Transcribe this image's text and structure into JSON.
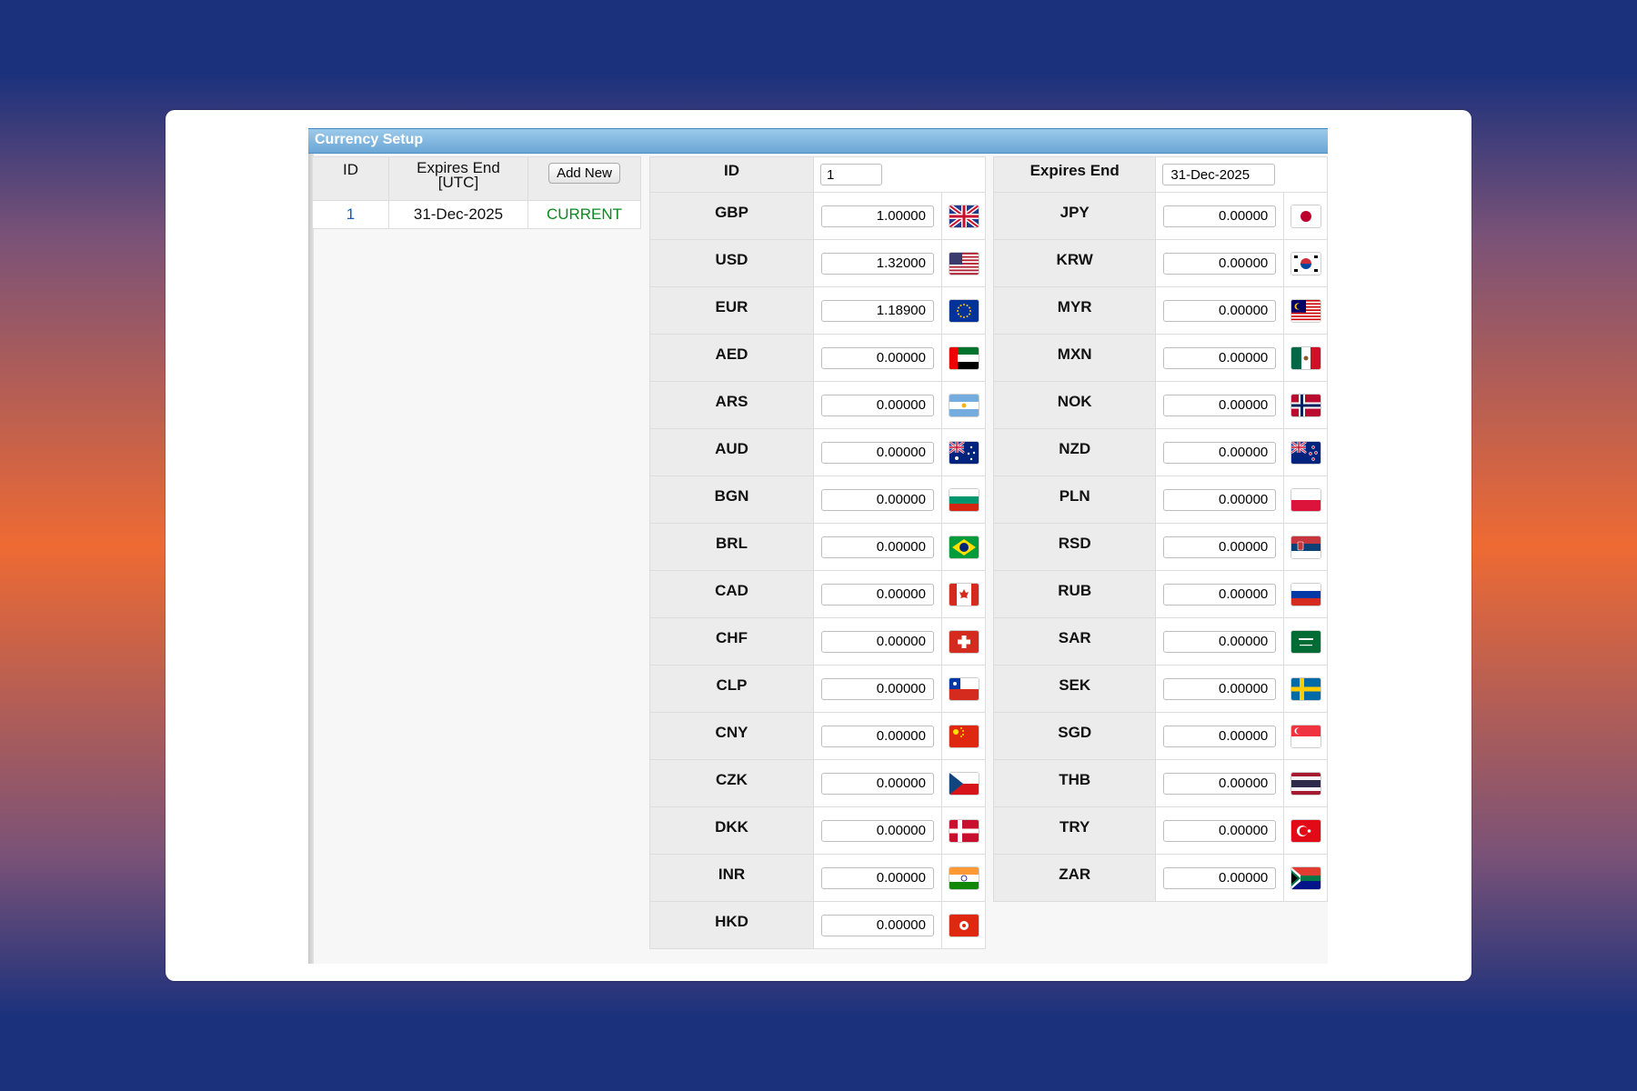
{
  "panel": {
    "title": "Currency Setup"
  },
  "list": {
    "headers": {
      "id": "ID",
      "expires_l1": "Expires End",
      "expires_l2": "[UTC]",
      "add_new": "Add New"
    },
    "rows": [
      {
        "id": "1",
        "expires": "31-Dec-2025",
        "status": "CURRENT"
      }
    ]
  },
  "form": {
    "id_label": "ID",
    "id_value": "1",
    "expires_label": "Expires End",
    "expires_value": "31-Dec-2025"
  },
  "rates_left": [
    {
      "code": "GBP",
      "value": "1.00000",
      "flag": "united-kingdom-flag-icon"
    },
    {
      "code": "USD",
      "value": "1.32000",
      "flag": "united-states-flag-icon"
    },
    {
      "code": "EUR",
      "value": "1.18900",
      "flag": "european-union-flag-icon"
    },
    {
      "code": "AED",
      "value": "0.00000",
      "flag": "uae-flag-icon"
    },
    {
      "code": "ARS",
      "value": "0.00000",
      "flag": "argentina-flag-icon"
    },
    {
      "code": "AUD",
      "value": "0.00000",
      "flag": "australia-flag-icon"
    },
    {
      "code": "BGN",
      "value": "0.00000",
      "flag": "bulgaria-flag-icon"
    },
    {
      "code": "BRL",
      "value": "0.00000",
      "flag": "brazil-flag-icon"
    },
    {
      "code": "CAD",
      "value": "0.00000",
      "flag": "canada-flag-icon"
    },
    {
      "code": "CHF",
      "value": "0.00000",
      "flag": "switzerland-flag-icon"
    },
    {
      "code": "CLP",
      "value": "0.00000",
      "flag": "chile-flag-icon"
    },
    {
      "code": "CNY",
      "value": "0.00000",
      "flag": "china-flag-icon"
    },
    {
      "code": "CZK",
      "value": "0.00000",
      "flag": "czech-flag-icon"
    },
    {
      "code": "DKK",
      "value": "0.00000",
      "flag": "denmark-flag-icon"
    },
    {
      "code": "INR",
      "value": "0.00000",
      "flag": "india-flag-icon"
    },
    {
      "code": "HKD",
      "value": "0.00000",
      "flag": "hong-kong-flag-icon"
    }
  ],
  "rates_right": [
    {
      "code": "JPY",
      "value": "0.00000",
      "flag": "japan-flag-icon"
    },
    {
      "code": "KRW",
      "value": "0.00000",
      "flag": "south-korea-flag-icon"
    },
    {
      "code": "MYR",
      "value": "0.00000",
      "flag": "malaysia-flag-icon"
    },
    {
      "code": "MXN",
      "value": "0.00000",
      "flag": "mexico-flag-icon"
    },
    {
      "code": "NOK",
      "value": "0.00000",
      "flag": "norway-flag-icon"
    },
    {
      "code": "NZD",
      "value": "0.00000",
      "flag": "new-zealand-flag-icon"
    },
    {
      "code": "PLN",
      "value": "0.00000",
      "flag": "poland-flag-icon"
    },
    {
      "code": "RSD",
      "value": "0.00000",
      "flag": "serbia-flag-icon"
    },
    {
      "code": "RUB",
      "value": "0.00000",
      "flag": "russia-flag-icon"
    },
    {
      "code": "SAR",
      "value": "0.00000",
      "flag": "saudi-arabia-flag-icon"
    },
    {
      "code": "SEK",
      "value": "0.00000",
      "flag": "sweden-flag-icon"
    },
    {
      "code": "SGD",
      "value": "0.00000",
      "flag": "singapore-flag-icon"
    },
    {
      "code": "THB",
      "value": "0.00000",
      "flag": "thailand-flag-icon"
    },
    {
      "code": "TRY",
      "value": "0.00000",
      "flag": "turkey-flag-icon"
    },
    {
      "code": "ZAR",
      "value": "0.00000",
      "flag": "south-africa-flag-icon"
    }
  ],
  "colors": {
    "background_top": "#1b317c",
    "background_mid": "#ee6a33",
    "titlebar": "#6aa6d6",
    "status_current": "#0a8a1f",
    "id_link": "#1a5bb8"
  }
}
